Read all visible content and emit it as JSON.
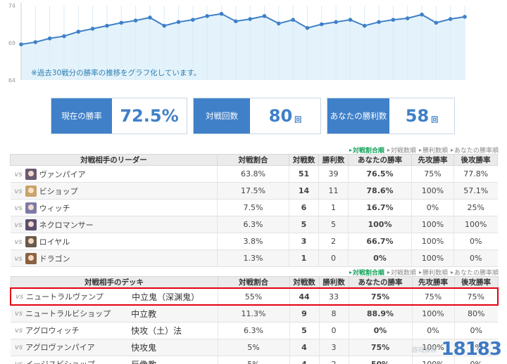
{
  "chart_data": {
    "type": "line",
    "ylim": [
      64,
      74
    ],
    "y_ticks": [
      "74",
      "69",
      "64"
    ],
    "values": [
      68.8,
      69.1,
      69.6,
      69.9,
      70.5,
      70.9,
      71.3,
      71.7,
      72.0,
      72.4,
      71.3,
      71.8,
      72.1,
      72.6,
      72.9,
      71.9,
      72.2,
      72.6,
      71.6,
      72.1,
      71.0,
      71.5,
      71.8,
      72.1,
      71.3,
      71.8,
      72.1,
      72.3,
      72.8,
      71.7,
      72.2,
      72.5
    ],
    "grid": true,
    "color": "#3f80c9",
    "fill": "#e4f3fb"
  },
  "chart_note": "※過去30戦分の勝率の推移をグラフ化しています。",
  "stats": [
    {
      "label": "現在の勝率",
      "value": "72.5%",
      "unit": ""
    },
    {
      "label": "対戦回数",
      "value": "80",
      "unit": "回"
    },
    {
      "label": "あなたの勝利数",
      "value": "58",
      "unit": "回"
    }
  ],
  "sort_links": [
    "対戦割合順",
    "対戦数順",
    "勝利数順",
    "あなたの勝率順"
  ],
  "leader_table": {
    "headers": [
      "対戦相手のリーダー",
      "対戦割合",
      "対戦数",
      "勝利数",
      "あなたの勝率",
      "先攻勝率",
      "後攻勝率"
    ],
    "rows": [
      {
        "vs": "vs",
        "icon": "vampire-icon",
        "icon_color": "#6b5a72",
        "name": "ヴァンパイア",
        "ratio": "63.8%",
        "count": "51",
        "wins": "39",
        "rate": "76.5%",
        "rate_class": "rate-red",
        "first": "75%",
        "second": "77.8%"
      },
      {
        "vs": "vs",
        "icon": "bishop-icon",
        "icon_color": "#c9a36a",
        "name": "ビショップ",
        "ratio": "17.5%",
        "count": "14",
        "wins": "11",
        "rate": "78.6%",
        "rate_class": "rate-red",
        "first": "100%",
        "second": "57.1%"
      },
      {
        "vs": "vs",
        "icon": "witch-icon",
        "icon_color": "#7e7aa8",
        "name": "ウィッチ",
        "ratio": "7.5%",
        "count": "6",
        "wins": "1",
        "rate": "16.7%",
        "rate_class": "rate-black",
        "first": "0%",
        "second": "25%"
      },
      {
        "vs": "vs",
        "icon": "necromancer-icon",
        "icon_color": "#5a4e6e",
        "name": "ネクロマンサー",
        "ratio": "6.3%",
        "count": "5",
        "wins": "5",
        "rate": "100%",
        "rate_class": "rate-red",
        "first": "100%",
        "second": "100%"
      },
      {
        "vs": "vs",
        "icon": "royal-icon",
        "icon_color": "#6a5a4a",
        "name": "ロイヤル",
        "ratio": "3.8%",
        "count": "3",
        "wins": "2",
        "rate": "66.7%",
        "rate_class": "rate-orange",
        "first": "100%",
        "second": "0%"
      },
      {
        "vs": "vs",
        "icon": "dragon-icon",
        "icon_color": "#8a6242",
        "name": "ドラゴン",
        "ratio": "1.3%",
        "count": "1",
        "wins": "0",
        "rate": "0%",
        "rate_class": "rate-black",
        "first": "100%",
        "second": "0%"
      }
    ]
  },
  "deck_table": {
    "headers": [
      "対戦相手のデッキ",
      "対戦割合",
      "対戦数",
      "勝利数",
      "あなたの勝率",
      "先攻勝率",
      "後攻勝率"
    ],
    "rows": [
      {
        "vs": "vs",
        "name": "ニュートラルヴァンプ",
        "arch": "中立鬼（深渊鬼）",
        "ratio": "55%",
        "count": "44",
        "wins": "33",
        "rate": "75%",
        "rate_class": "rate-red",
        "first": "75%",
        "second": "75%"
      },
      {
        "vs": "vs",
        "name": "ニュートラルビショップ",
        "arch": "中立教",
        "ratio": "11.3%",
        "count": "9",
        "wins": "8",
        "rate": "88.9%",
        "rate_class": "rate-red",
        "first": "100%",
        "second": "80%"
      },
      {
        "vs": "vs",
        "name": "アグロウィッチ",
        "arch": "快攻（土）法",
        "ratio": "6.3%",
        "count": "5",
        "wins": "0",
        "rate": "0%",
        "rate_class": "rate-black",
        "first": "0%",
        "second": "0%"
      },
      {
        "vs": "vs",
        "name": "アグロヴァンパイア",
        "arch": "快攻鬼",
        "ratio": "5%",
        "count": "4",
        "wins": "3",
        "rate": "75%",
        "rate_class": "rate-red",
        "first": "100%",
        "second": "0%"
      },
      {
        "vs": "vs",
        "name": "イージスビショップ",
        "arch": "巨像教",
        "ratio": "5%",
        "count": "4",
        "wins": "2",
        "rate": "50%",
        "rate_class": "rate-orange",
        "first": "100%",
        "second": "0%"
      }
    ]
  },
  "watermark": {
    "text": "18183",
    "sub": "游戏推荐"
  }
}
